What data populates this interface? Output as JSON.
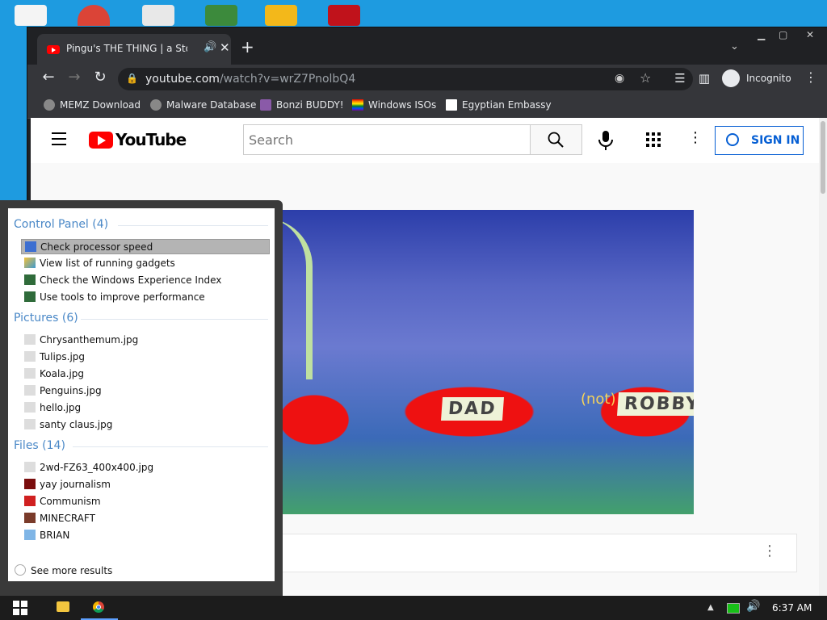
{
  "browser": {
    "tab_title": "Pingu's THE THING | a Stop m",
    "tab_speaker": "🔊",
    "tab_close": "✕",
    "new_tab": "+",
    "url_host": "youtube.com",
    "url_path": "/watch?v=wrZ7PnolbQ4",
    "incognito_label": "Incognito",
    "bookmarks": [
      "MEMZ Download",
      "Malware Database",
      "Bonzi BUDDY!",
      "Windows ISOs",
      "Egyptian Embassy"
    ]
  },
  "youtube": {
    "logo_text": "YouTube",
    "search_placeholder": "Search",
    "sign_in_label": "SIGN IN",
    "video_labels": {
      "dad": "DAD",
      "robby": "ROBBY",
      "caption": "(not)"
    }
  },
  "start_search": {
    "groups": [
      {
        "title": "Control Panel (4)",
        "items": [
          "Check processor speed",
          "View list of running gadgets",
          "Check the Windows Experience Index",
          "Use tools to improve performance"
        ]
      },
      {
        "title": "Pictures (6)",
        "items": [
          "Chrysanthemum.jpg",
          "Tulips.jpg",
          "Koala.jpg",
          "Penguins.jpg",
          "hello.jpg",
          "santy claus.jpg"
        ]
      },
      {
        "title": "Files (14)",
        "items": [
          "2wd-FZ63_400x400.jpg",
          "yay journalism",
          "Communism",
          "MINECRAFT",
          "BRIAN"
        ]
      }
    ],
    "see_more": "See more results"
  },
  "taskbar": {
    "clock": "6:37 AM"
  },
  "colors": {
    "desktop": "#1e9be0",
    "chrome_dark": "#202124",
    "youtube_red": "#ff0000",
    "link_blue": "#065fd4",
    "group_blue": "#4a88c7"
  }
}
